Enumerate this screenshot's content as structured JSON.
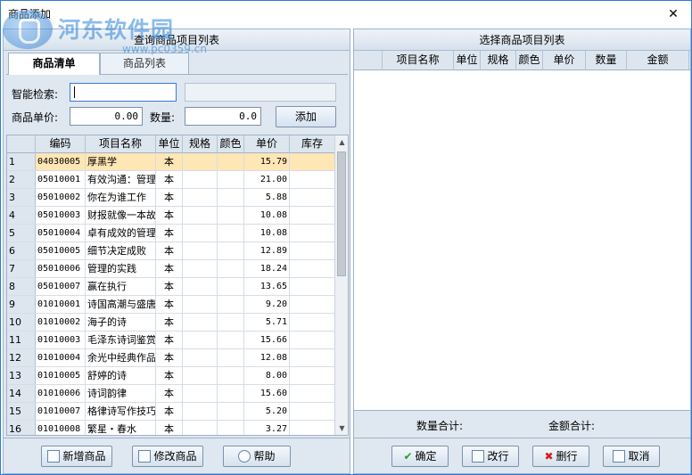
{
  "window": {
    "title": "商品添加",
    "close_label": "✕"
  },
  "watermark": {
    "site_name": "河东软件园",
    "url": "www.pc0359.cn"
  },
  "left": {
    "header": "查询商品项目列表",
    "tabs": [
      {
        "label": "商品清单",
        "active": true
      },
      {
        "label": "商品列表",
        "active": false
      }
    ],
    "search_label": "智能检索:",
    "search_value": "",
    "price_label": "商品单价:",
    "price_value": "0.00",
    "qty_label": "数量:",
    "qty_value": "0.0",
    "add_button": "添加",
    "columns": [
      "",
      "编码",
      "项目名称",
      "单位",
      "规格",
      "颜色",
      "单价",
      "库存"
    ],
    "rows": [
      [
        "1",
        "04030005",
        "厚黑学",
        "本",
        "",
        "",
        "15.79",
        ""
      ],
      [
        "2",
        "05010001",
        "有效沟通：管理",
        "本",
        "",
        "",
        "21.00",
        ""
      ],
      [
        "3",
        "05010002",
        "你在为谁工作",
        "本",
        "",
        "",
        "5.88",
        ""
      ],
      [
        "4",
        "05010003",
        "财报就像一本故",
        "本",
        "",
        "",
        "10.08",
        ""
      ],
      [
        "5",
        "05010004",
        "卓有成效的管理",
        "本",
        "",
        "",
        "10.08",
        ""
      ],
      [
        "6",
        "05010005",
        "细节决定成败",
        "本",
        "",
        "",
        "12.89",
        ""
      ],
      [
        "7",
        "05010006",
        "管理的实践",
        "本",
        "",
        "",
        "18.24",
        ""
      ],
      [
        "8",
        "05010007",
        "赢在执行",
        "本",
        "",
        "",
        "13.65",
        ""
      ],
      [
        "9",
        "01010001",
        "诗国高潮与盛唐",
        "本",
        "",
        "",
        "9.20",
        ""
      ],
      [
        "10",
        "01010002",
        "海子的诗",
        "本",
        "",
        "",
        "5.71",
        ""
      ],
      [
        "11",
        "01010003",
        "毛泽东诗词鉴赏",
        "本",
        "",
        "",
        "15.66",
        ""
      ],
      [
        "12",
        "01010004",
        "余光中经典作品",
        "本",
        "",
        "",
        "12.08",
        ""
      ],
      [
        "13",
        "01010005",
        "舒婷的诗",
        "本",
        "",
        "",
        "8.00",
        ""
      ],
      [
        "14",
        "01010006",
        "诗词韵律",
        "本",
        "",
        "",
        "15.60",
        ""
      ],
      [
        "15",
        "01010007",
        "格律诗写作技巧",
        "本",
        "",
        "",
        "5.20",
        ""
      ],
      [
        "16",
        "01010008",
        "繁星・春水",
        "本",
        "",
        "",
        "3.27",
        ""
      ]
    ],
    "footer_buttons": [
      "新增商品",
      "修改商品",
      "帮助"
    ]
  },
  "right": {
    "header": "选择商品项目列表",
    "columns": [
      "",
      "项目名称",
      "单位",
      "规格",
      "颜色",
      "单价",
      "数量",
      "金额"
    ],
    "qty_total_label": "数量合计:",
    "amount_total_label": "金额合计:",
    "footer_buttons": [
      "确定",
      "改行",
      "删行",
      "取消"
    ]
  }
}
